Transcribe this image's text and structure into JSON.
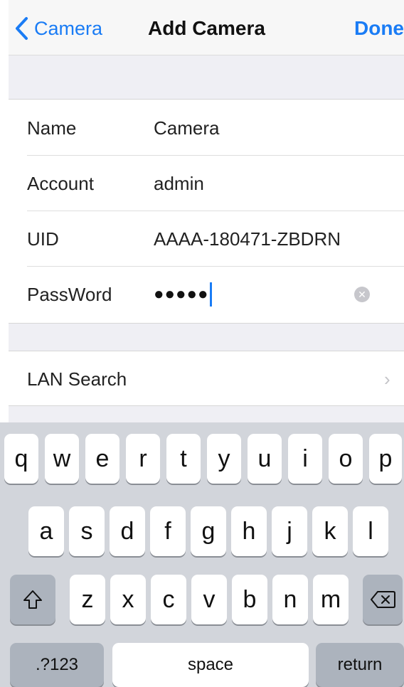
{
  "navbar": {
    "back_label": "Camera",
    "title": "Add Camera",
    "done_label": "Done"
  },
  "form": {
    "name_label": "Name",
    "name_value": "Camera",
    "account_label": "Account",
    "account_value": "admin",
    "uid_label": "UID",
    "uid_value": "AAAA-180471-ZBDRN",
    "password_label": "PassWord",
    "password_masked": "●●●●●"
  },
  "lan_search": {
    "label": "LAN Search",
    "chevron": "›"
  },
  "keyboard": {
    "row1": [
      "q",
      "w",
      "e",
      "r",
      "t",
      "y",
      "u",
      "i",
      "o",
      "p"
    ],
    "row2": [
      "a",
      "s",
      "d",
      "f",
      "g",
      "h",
      "j",
      "k",
      "l"
    ],
    "row3": [
      "z",
      "x",
      "c",
      "v",
      "b",
      "n",
      "m"
    ],
    "numbers_label": ".?123",
    "space_label": "space",
    "return_label": "return",
    "shift_icon": "shift-icon",
    "delete_icon": "backspace-icon"
  }
}
